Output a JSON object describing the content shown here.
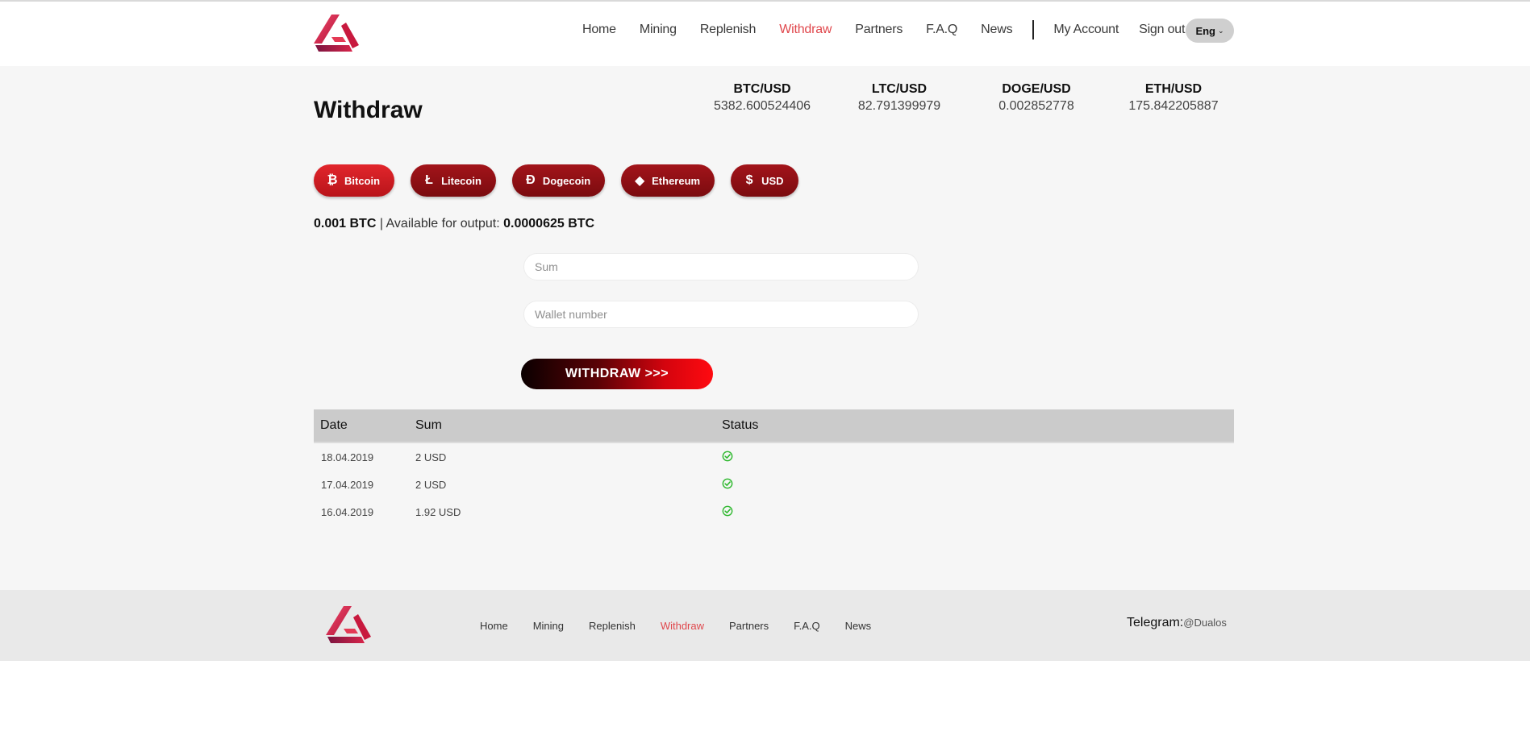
{
  "nav": {
    "items": [
      "Home",
      "Mining",
      "Replenish",
      "Withdraw",
      "Partners",
      "F.A.Q",
      "News"
    ],
    "active": "Withdraw",
    "account": "My Account",
    "signout": "Sign out",
    "lang": "Eng"
  },
  "page": {
    "title": "Withdraw"
  },
  "rates": [
    {
      "pair": "BTC/USD",
      "value": "5382.600524406"
    },
    {
      "pair": "LTC/USD",
      "value": "82.791399979"
    },
    {
      "pair": "DOGE/USD",
      "value": "0.002852778"
    },
    {
      "pair": "ETH/USD",
      "value": "175.842205887"
    }
  ],
  "coins": [
    {
      "label": "Bitcoin",
      "glyph": "₿",
      "icon": "bitcoin-icon",
      "active": true
    },
    {
      "label": "Litecoin",
      "glyph": "Ł",
      "icon": "litecoin-icon",
      "active": false
    },
    {
      "label": "Dogecoin",
      "glyph": "Ð",
      "icon": "dogecoin-icon",
      "active": false
    },
    {
      "label": "Ethereum",
      "glyph": "◆",
      "icon": "ethereum-icon",
      "active": false
    },
    {
      "label": "USD",
      "glyph": "$",
      "icon": "dollar-icon",
      "active": false
    }
  ],
  "balance": {
    "amount": "0.001 BTC",
    "separator": " | ",
    "available_label": "Available for output: ",
    "available": "0.0000625 BTC"
  },
  "form": {
    "sum_placeholder": "Sum",
    "wallet_placeholder": "Wallet number",
    "submit_label": "WITHDRAW >>>"
  },
  "table": {
    "headers": {
      "date": "Date",
      "sum": "Sum",
      "status": "Status"
    },
    "rows": [
      {
        "date": "18.04.2019",
        "sum": "2 USD",
        "status": "check-icon"
      },
      {
        "date": "17.04.2019",
        "sum": "2 USD",
        "status": "check-icon"
      },
      {
        "date": "16.04.2019",
        "sum": "1.92 USD",
        "status": "check-icon"
      }
    ]
  },
  "footer": {
    "nav": [
      "Home",
      "Mining",
      "Replenish",
      "Withdraw",
      "Partners",
      "F.A.Q",
      "News"
    ],
    "active": "Withdraw",
    "telegram_label": "Telegram:",
    "telegram_handle": "@Dualos"
  },
  "colors": {
    "accent": "#e0474c",
    "coin_button": "#8e0f14",
    "coin_active": "#d41b22",
    "success": "#2eb82e"
  }
}
